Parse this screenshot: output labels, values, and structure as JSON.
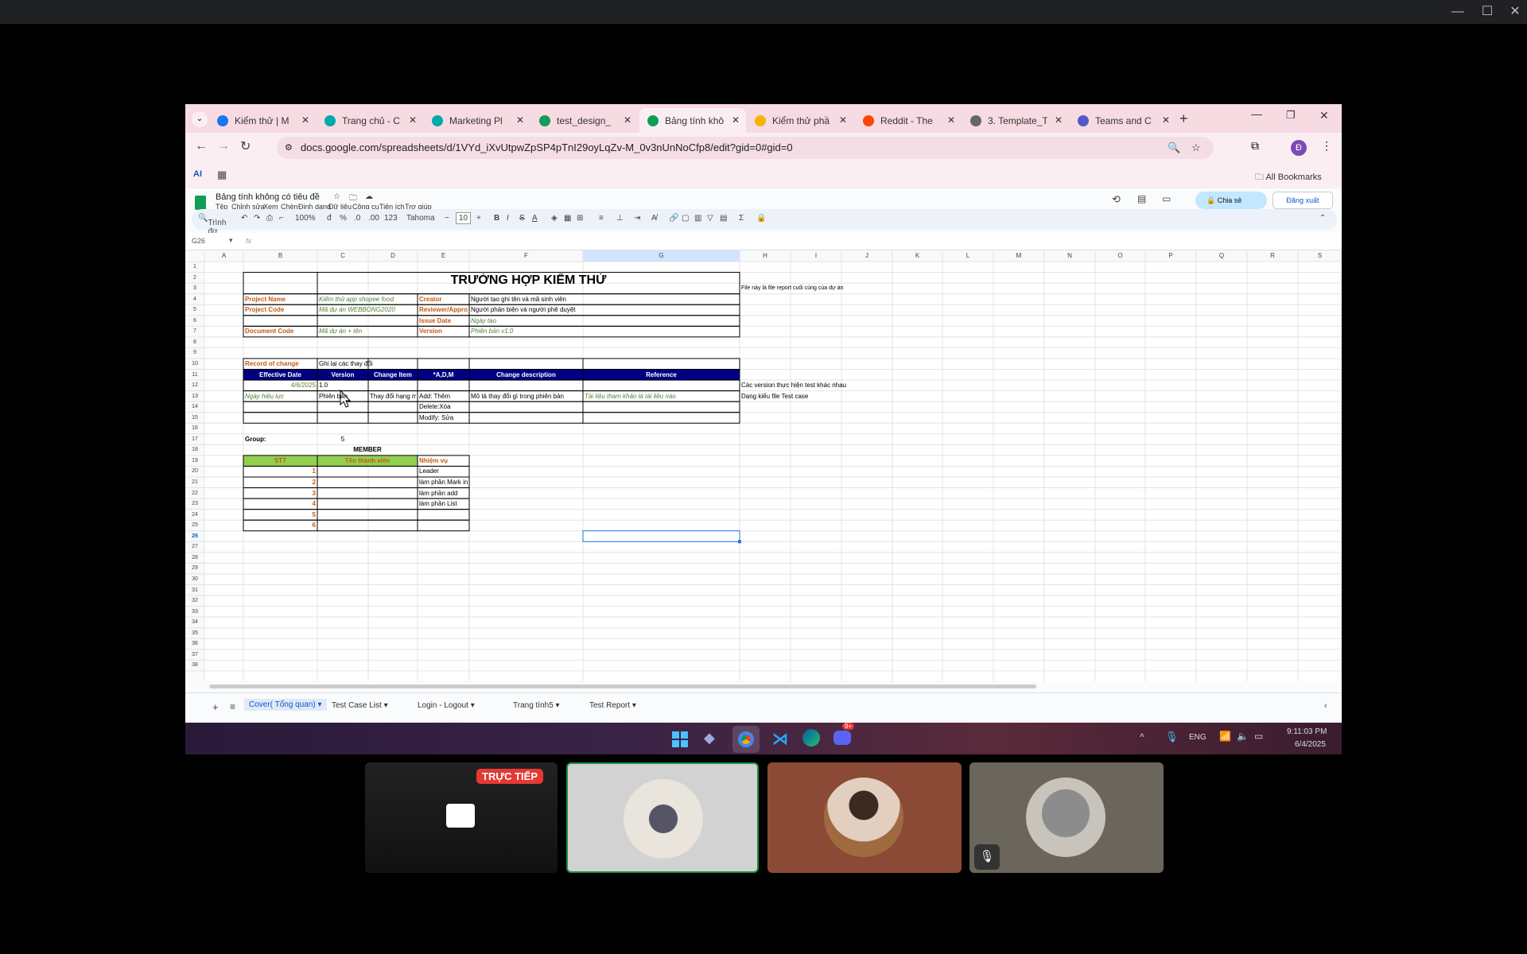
{
  "window": {
    "min": "—",
    "max": "☐",
    "close": "✕"
  },
  "tabs": [
    {
      "title": "Kiểm thử | M",
      "icon": "messenger-icon",
      "color": "#1877f2"
    },
    {
      "title": "Trang chủ - C",
      "icon": "canva-icon",
      "color": "#0aa"
    },
    {
      "title": "Marketing Pl",
      "icon": "canva-icon",
      "color": "#0aa"
    },
    {
      "title": "test_design_",
      "icon": "sheets-icon",
      "color": "#0f9d58"
    },
    {
      "title": "Bảng tính khô",
      "icon": "sheets-icon",
      "color": "#0f9d58"
    },
    {
      "title": "Kiểm thử phầ",
      "icon": "drive-icon",
      "color": "#f4b400"
    },
    {
      "title": "Reddit - The",
      "icon": "reddit-icon",
      "color": "#ff4500"
    },
    {
      "title": "3. Template_T",
      "icon": "globe-icon",
      "color": "#666"
    },
    {
      "title": "Teams and C",
      "icon": "teams-icon",
      "color": "#5059c9"
    }
  ],
  "address": {
    "url": "docs.google.com/spreadsheets/d/1VYd_iXvUtpwZpSP4pTnI29oyLqZv-M_0v3nUnNoCfp8/edit?gid=0#gid=0"
  },
  "bookmarks": {
    "ai": "AI",
    "all": "All Bookmarks"
  },
  "sheet": {
    "title": "Bảng tính không có tiêu đề",
    "menus": [
      "Tệp",
      "Chỉnh sửa",
      "Xem",
      "Chèn",
      "Định dạng",
      "Dữ liệu",
      "Công cụ",
      "Tiện ích",
      "Trợ giúp"
    ],
    "share": "Chia sẻ",
    "logout": "Đăng xuất",
    "toolbar": {
      "search": "Trình đơ",
      "zoom": "100%",
      "currency": "đ",
      "percent": "%",
      "dec1": ".0",
      "dec2": ".00",
      "num": "123",
      "font": "Tahoma",
      "size": "10",
      "bold": "B",
      "italic": "I"
    },
    "namebox": "G26",
    "fx": "fx",
    "cols": [
      "A",
      "B",
      "C",
      "D",
      "E",
      "F",
      "G",
      "H",
      "I",
      "J",
      "K",
      "L",
      "M",
      "N",
      "O",
      "P",
      "Q",
      "R",
      "S"
    ],
    "rows": [
      "1",
      "2",
      "3",
      "4",
      "5",
      "6",
      "7",
      "8",
      "9",
      "10",
      "11",
      "12",
      "13",
      "14",
      "15",
      "16",
      "17",
      "18",
      "19",
      "20",
      "21",
      "22",
      "23",
      "24",
      "25",
      "26",
      "27",
      "28",
      "29",
      "30",
      "31",
      "32",
      "33",
      "34",
      "35",
      "36",
      "37",
      "38"
    ],
    "heading": "TRƯỜNG HỢP KIỂM THỬ",
    "note": "File này là file report cuối cùng của dự án",
    "info": {
      "project_name": "Project Name",
      "project_name_v": "Kiểm thử app shopee food",
      "project_code": "Project Code",
      "project_code_v": "Mã dự án WEBBONG2020",
      "document_code": "Document Code",
      "document_code_v": "Mã dự án + tên",
      "creator": "Creator",
      "creator_v": "Người tạo ghi tên và mã sinh viên",
      "reviewer": "Reviewer/Approver",
      "reviewer_v": "Người phản biện và người phê duyệt",
      "issue": "Issue Date",
      "issue_v": "Ngày tạo",
      "version": "Version",
      "version_v": "Phiên bản v1.0"
    },
    "record": {
      "label": "Record of change",
      "value": "Ghi lại các thay đổi"
    },
    "changes_header": [
      "Effective Date",
      "Version",
      "Change Item",
      "*A,D,M",
      "Change description",
      "Reference"
    ],
    "change_row1": {
      "date": "4/6/2025",
      "version": "1.0"
    },
    "change_row2": {
      "date": "Ngày hiệu lực",
      "version": "Phiên bản",
      "item": "Thay đổi hạng m",
      "amd": "Add: Thêm",
      "desc": "Mô tả thay đổi gì trong phiên bản",
      "ref": "Tài liệu tham khảo là tài liệu nào"
    },
    "change_row3": {
      "amd": "Delete:Xóa"
    },
    "change_row4": {
      "amd": "Modify: Sửa"
    },
    "side_notes": [
      "Các version thực hiện test khác nhau",
      "Dạng kiểu file Test case"
    ],
    "group": {
      "label": "Group:",
      "value": "5"
    },
    "member_title": "MEMBER",
    "member_header": [
      "STT",
      "Tên thành viên",
      "Nhiệm vụ"
    ],
    "members": [
      {
        "stt": "1",
        "task": "Leader"
      },
      {
        "stt": "2",
        "task": "làm phần Mark in-active"
      },
      {
        "stt": "3",
        "task": "làm phần add"
      },
      {
        "stt": "4",
        "task": "làm phần List"
      },
      {
        "stt": "5",
        "task": ""
      },
      {
        "stt": "6",
        "task": ""
      }
    ],
    "sheet_tabs": [
      "Cover( Tổng quan)",
      "Test Case List",
      "Login - Logout",
      "Trang tính5",
      "Test Report"
    ]
  },
  "taskbar": {
    "lang": "ENG",
    "time": "9:11:03 PM",
    "date": "6/4/2025",
    "discord_badge": "9+"
  },
  "meet": {
    "live_badge": "TRỰC TIẾP"
  },
  "colors": {
    "accent": "#0b57d0",
    "header_blue": "#000080",
    "label_orange": "#c55a11",
    "green": "#548235",
    "member_green": "#92d050"
  }
}
